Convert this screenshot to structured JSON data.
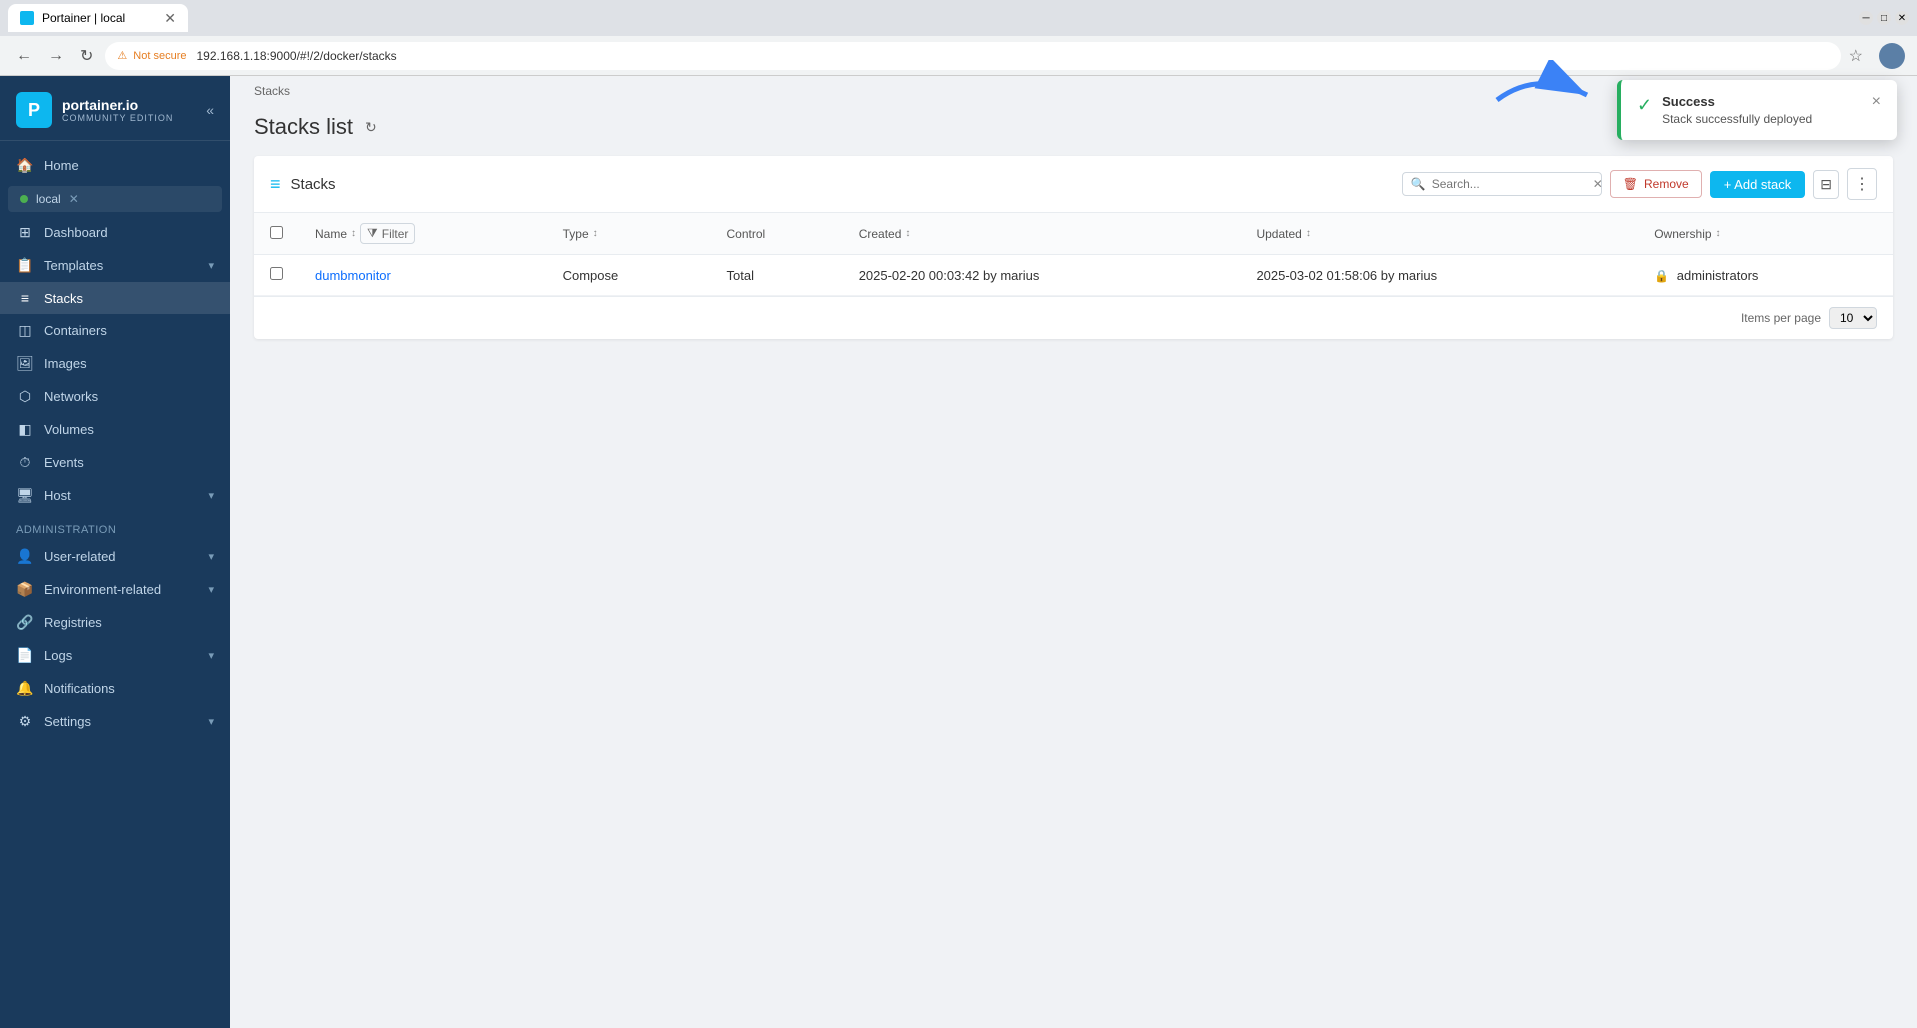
{
  "browser": {
    "tab_title": "Portainer | local",
    "address": "192.168.1.18:9000/#!/2/docker/stacks",
    "security_label": "Not secure"
  },
  "sidebar": {
    "logo_title": "portainer.io",
    "logo_subtitle": "COMMUNITY EDITION",
    "home_label": "Home",
    "env_name": "local",
    "nav_items": [
      {
        "id": "dashboard",
        "label": "Dashboard",
        "icon": "⊞"
      },
      {
        "id": "templates",
        "label": "Templates",
        "icon": "📋"
      },
      {
        "id": "stacks",
        "label": "Stacks",
        "icon": "≡",
        "active": true
      },
      {
        "id": "containers",
        "label": "Containers",
        "icon": "◫"
      },
      {
        "id": "images",
        "label": "Images",
        "icon": "🖼"
      },
      {
        "id": "networks",
        "label": "Networks",
        "icon": "⬡"
      },
      {
        "id": "volumes",
        "label": "Volumes",
        "icon": "◧"
      },
      {
        "id": "events",
        "label": "Events",
        "icon": "⏱"
      },
      {
        "id": "host",
        "label": "Host",
        "icon": "🖥"
      }
    ],
    "admin_label": "Administration",
    "admin_items": [
      {
        "id": "user-related",
        "label": "User-related",
        "icon": "👤"
      },
      {
        "id": "environment-related",
        "label": "Environment-related",
        "icon": "📦"
      },
      {
        "id": "registries",
        "label": "Registries",
        "icon": "🔗"
      },
      {
        "id": "logs",
        "label": "Logs",
        "icon": "📄"
      },
      {
        "id": "notifications",
        "label": "Notifications",
        "icon": "🔔"
      },
      {
        "id": "settings",
        "label": "Settings",
        "icon": "⚙"
      }
    ]
  },
  "page": {
    "breadcrumb": "Stacks",
    "title": "Stacks list",
    "section_title": "Stacks"
  },
  "table": {
    "search_placeholder": "Search...",
    "remove_label": "Remove",
    "add_stack_label": "+ Add stack",
    "columns": {
      "name": "Name",
      "type": "Type",
      "control": "Control",
      "created": "Created",
      "updated": "Updated",
      "ownership": "Ownership"
    },
    "rows": [
      {
        "name": "dumbmonitor",
        "type": "Compose",
        "control": "Total",
        "created": "2025-02-20 00:03:42 by marius",
        "updated": "2025-03-02 01:58:06 by marius",
        "ownership": "administrators"
      }
    ],
    "items_per_page_label": "Items per page",
    "items_per_page_value": "10"
  },
  "toast": {
    "title": "Success",
    "message": "Stack successfully deployed",
    "close_label": "×"
  },
  "colors": {
    "primary": "#0db7ef",
    "success": "#27ae60",
    "danger": "#c0392b",
    "sidebar_bg": "#1a3a5c"
  }
}
